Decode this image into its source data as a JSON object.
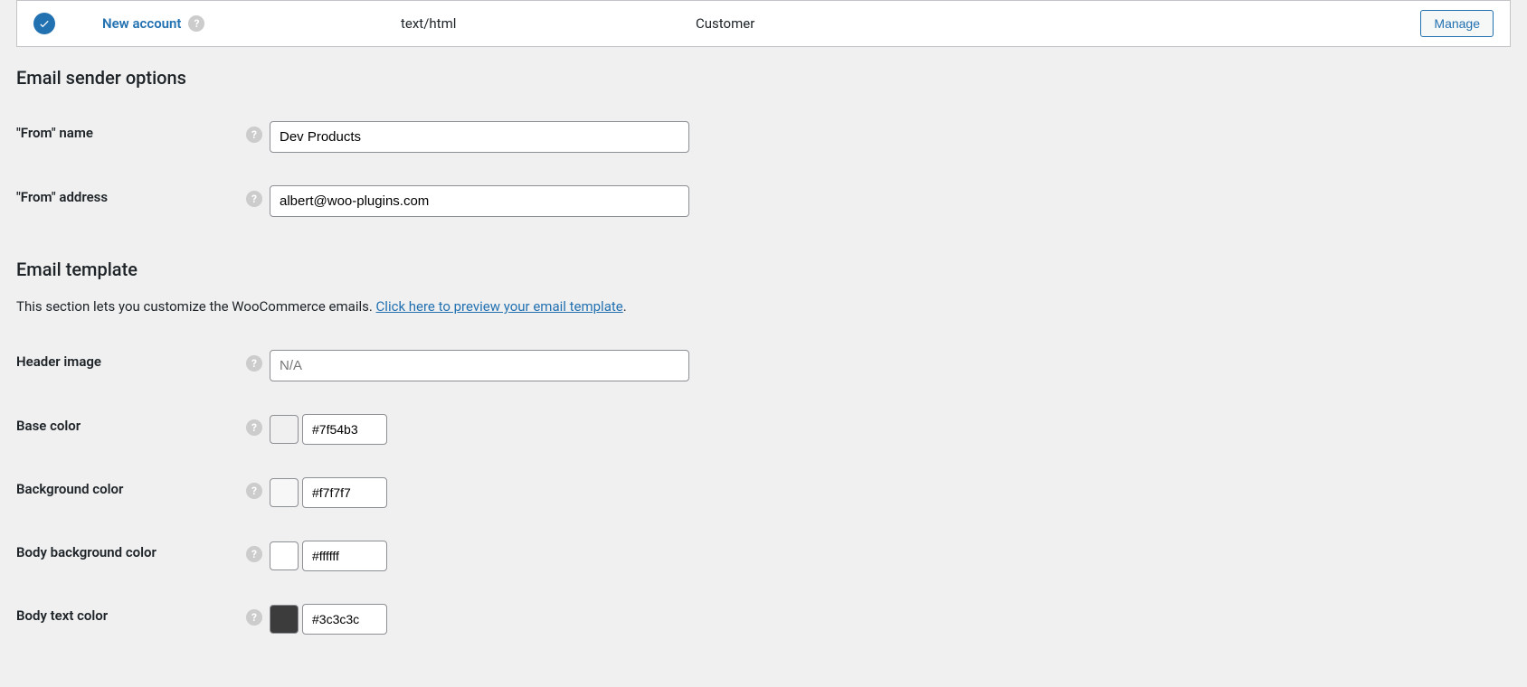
{
  "email_row": {
    "name": "New account",
    "content_type": "text/html",
    "recipient": "Customer",
    "manage_label": "Manage"
  },
  "sender_options": {
    "heading": "Email sender options",
    "from_name": {
      "label": "\"From\" name",
      "value": "Dev Products"
    },
    "from_address": {
      "label": "\"From\" address",
      "value": "albert@woo-plugins.com"
    }
  },
  "email_template": {
    "heading": "Email template",
    "desc_before_link": "This section lets you customize the WooCommerce emails. ",
    "desc_link": "Click here to preview your email template",
    "desc_after_link": ".",
    "header_image": {
      "label": "Header image",
      "value": "",
      "placeholder": "N/A"
    },
    "base_color": {
      "label": "Base color",
      "value": "#7f54b3"
    },
    "background_color": {
      "label": "Background color",
      "value": "#f7f7f7"
    },
    "body_background_color": {
      "label": "Body background color",
      "value": "#ffffff"
    },
    "body_text_color": {
      "label": "Body text color",
      "value": "#3c3c3c"
    }
  },
  "colors": {
    "base": "#7f54b3",
    "background": "#f7f7f7",
    "body_background": "#ffffff",
    "body_text": "#3c3c3c"
  }
}
